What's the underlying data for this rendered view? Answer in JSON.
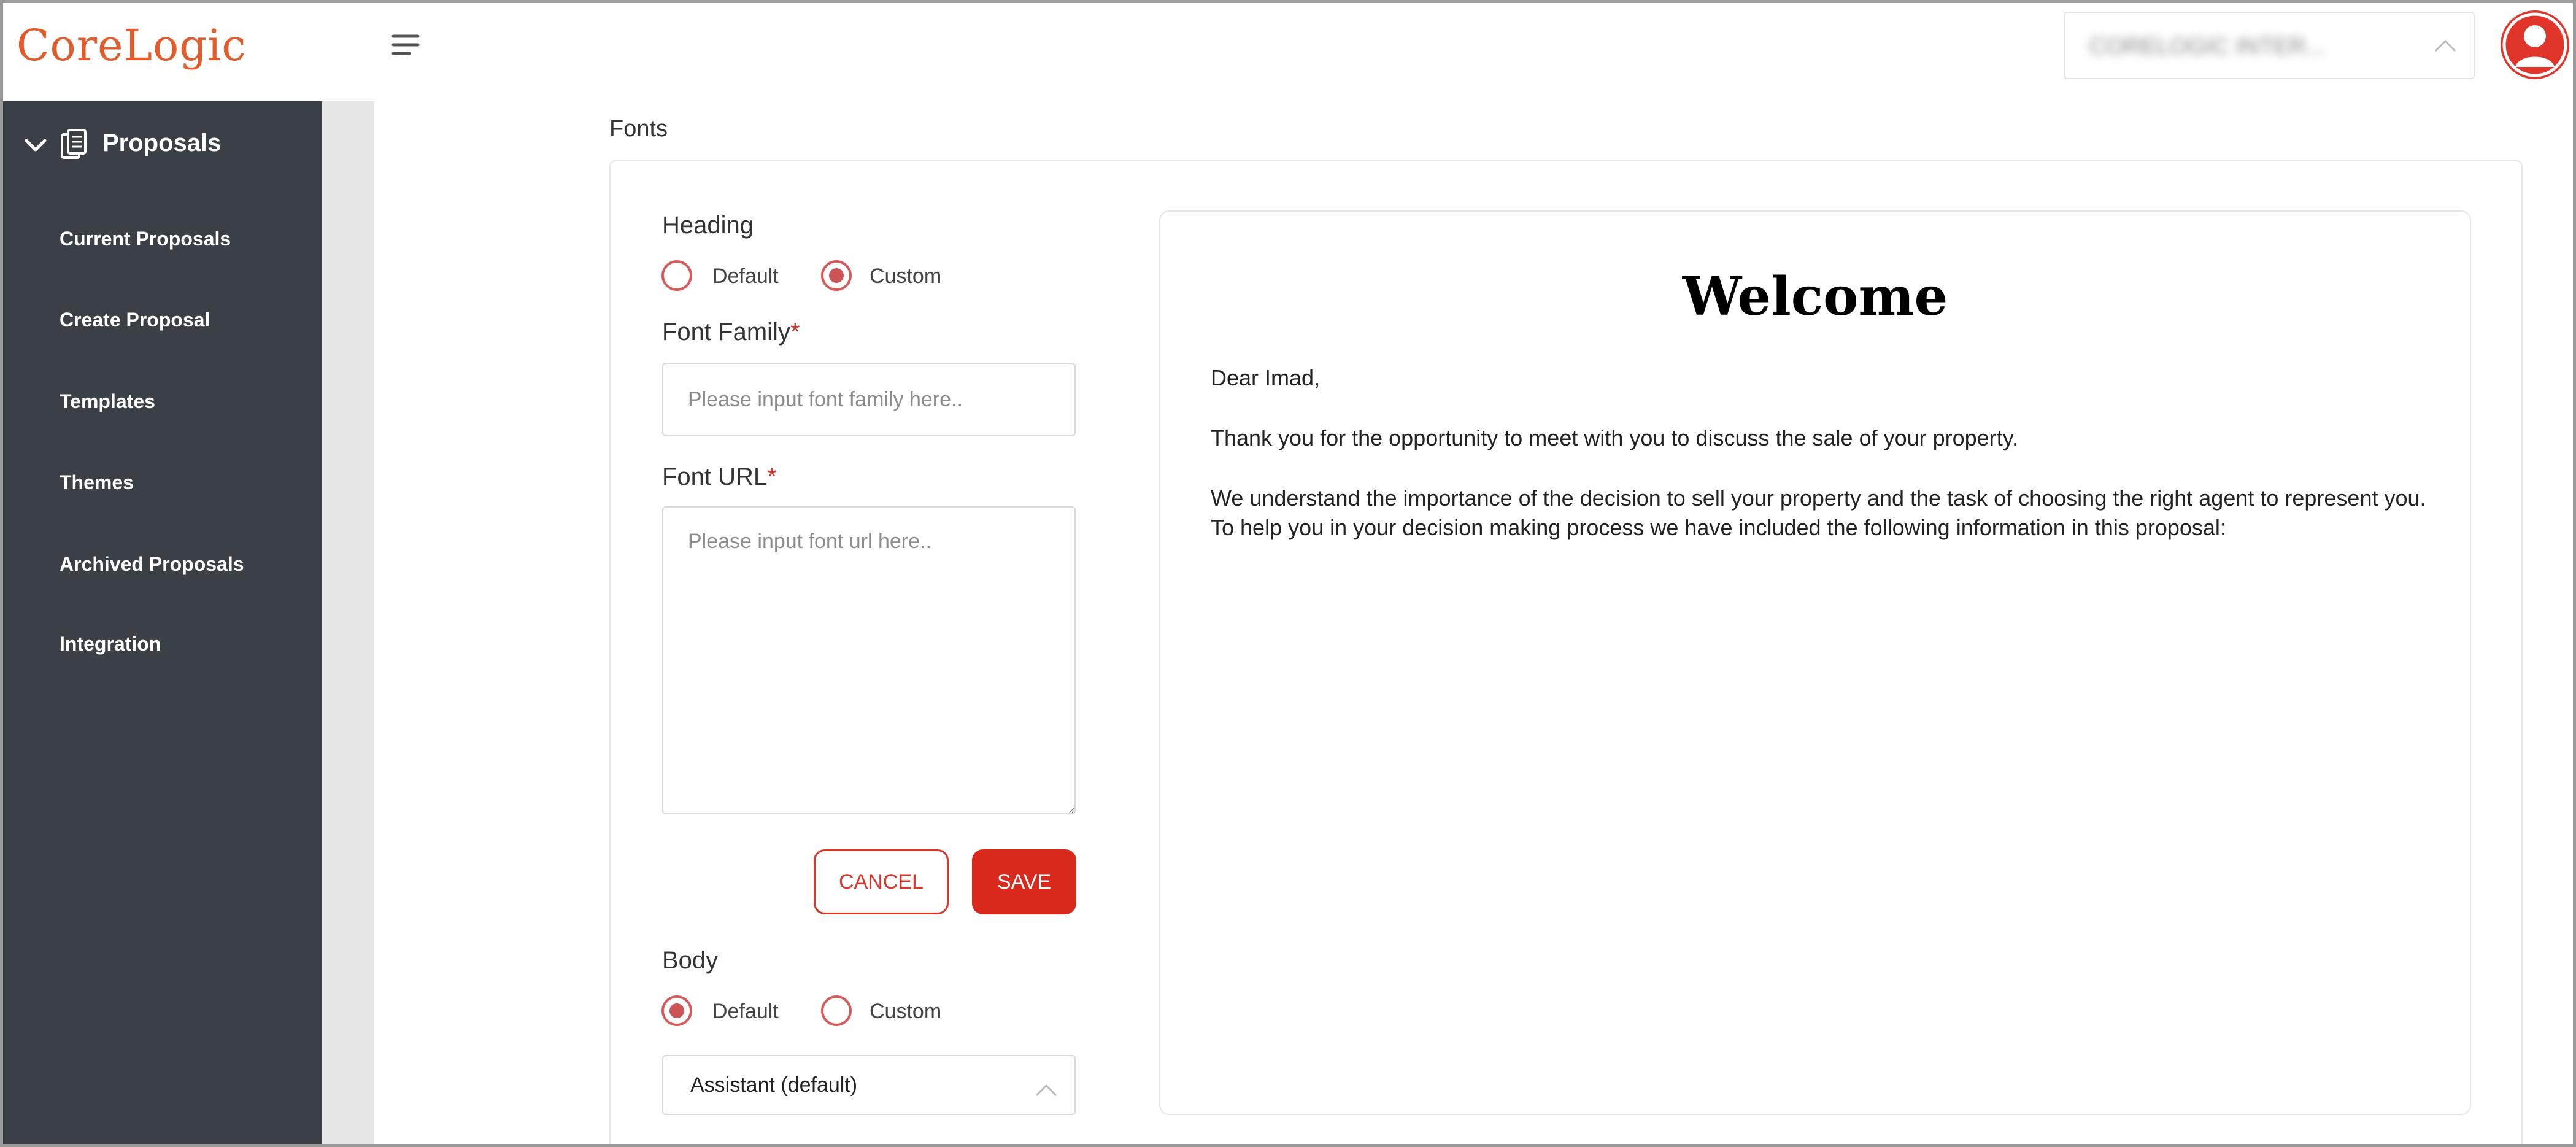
{
  "brand": {
    "logo_text": "CoreLogic",
    "accent": "#e35a2b"
  },
  "sidebar": {
    "section_label": "Proposals",
    "items": [
      {
        "label": "Current Proposals"
      },
      {
        "label": "Create Proposal"
      },
      {
        "label": "Templates"
      },
      {
        "label": "Themes"
      },
      {
        "label": "Archived Proposals"
      },
      {
        "label": "Integration"
      }
    ]
  },
  "topbar": {
    "menu_icon": "hamburger-icon",
    "account_select_value": "CORELOGIC INTER...",
    "user_icon": "user-avatar-icon"
  },
  "fonts": {
    "section_title": "Fonts",
    "heading": {
      "label": "Heading",
      "options": [
        "Default",
        "Custom"
      ],
      "selected": "Custom",
      "font_family_label": "Font Family",
      "font_family_placeholder": "Please input font family here..",
      "font_url_label": "Font URL",
      "font_url_placeholder": "Please input font url here..",
      "required_mark": "*"
    },
    "actions": {
      "cancel": "CANCEL",
      "save": "SAVE"
    },
    "body": {
      "label": "Body",
      "options": [
        "Default",
        "Custom"
      ],
      "selected": "Default",
      "font_select_value": "Assistant (default)"
    }
  },
  "preview": {
    "title": "Welcome",
    "greeting": "Dear Imad,",
    "paragraph1": "Thank you for the opportunity to meet with you to discuss the sale of your property.",
    "paragraph2_line1": "We understand the importance of the decision to sell your property and the task of choosing the right agent to represent you.",
    "paragraph2_line2": "To help you in your decision making process we have included the following information in this proposal:"
  },
  "colors": {
    "sidebar_bg": "#3b4047",
    "primary_red": "#d9291c",
    "radio_red": "#cc5454"
  }
}
